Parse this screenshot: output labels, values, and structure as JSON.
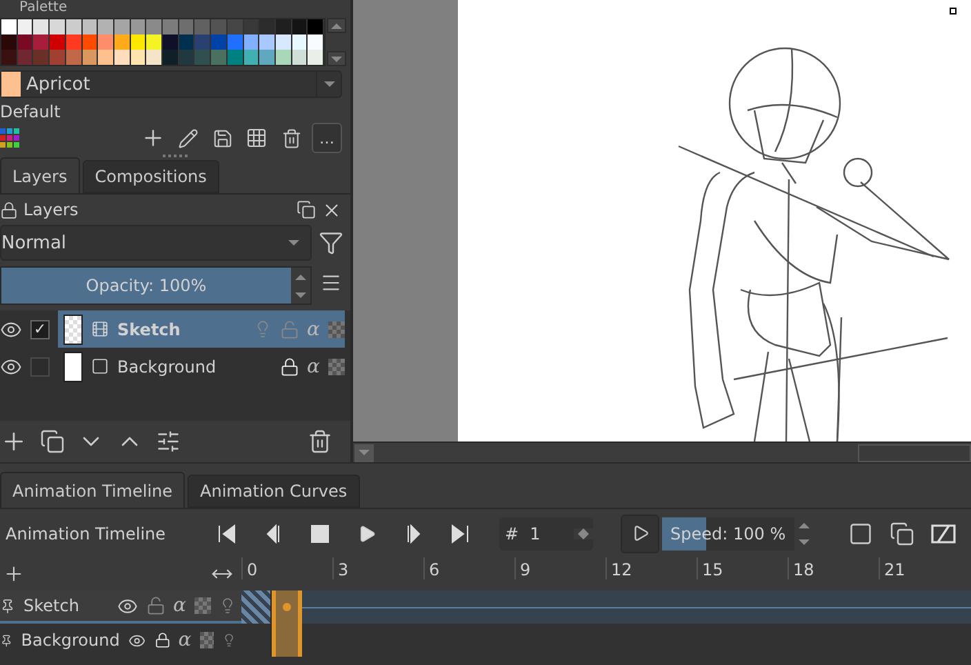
{
  "palette": {
    "title": "Palette",
    "swatches": [
      [
        {
          "color": "#ffffff"
        },
        {
          "color": "#f0f0f0"
        },
        {
          "color": "#e4e4e4"
        },
        {
          "color": "#d8d8d8"
        },
        {
          "color": "#cccccc"
        },
        {
          "color": "#bfbfbf"
        },
        {
          "color": "#b2b2b2"
        },
        {
          "color": "#a5a5a5"
        },
        {
          "color": "#989898"
        },
        {
          "color": "#8a8a8a"
        },
        {
          "color": "#7c7c7c"
        },
        {
          "color": "#6e6e6e"
        },
        {
          "color": "#616161"
        },
        {
          "color": "#535353"
        },
        {
          "color": "#464646"
        },
        {
          "color": "#393939"
        },
        {
          "color": "#2c2c2c"
        },
        {
          "color": "#1f1f1f"
        },
        {
          "color": "#141414"
        },
        {
          "color": "#000000"
        }
      ],
      [
        {
          "color": "#2a0808"
        },
        {
          "color": "#7a0a24"
        },
        {
          "color": "#a81e3a"
        },
        {
          "color": "#d00000"
        },
        {
          "color": "#ff3a20"
        },
        {
          "color": "#ff4a00"
        },
        {
          "color": "#ff8c6a"
        },
        {
          "color": "#ffaa18"
        },
        {
          "color": "#ffe800"
        },
        {
          "color": "#f4f424"
        },
        {
          "color": "#10102a"
        },
        {
          "color": "#003050"
        },
        {
          "color": "#2a4070"
        },
        {
          "color": "#0042a8"
        },
        {
          "color": "#2070ff"
        },
        {
          "color": "#80b0ff"
        },
        {
          "color": "#a8c8ff"
        },
        {
          "color": "#d8e8ff"
        },
        {
          "color": "#e8f8ff"
        },
        {
          "color": "#f8fcff"
        }
      ],
      [
        {
          "color": "#3a1010"
        },
        {
          "color": "#702830"
        },
        {
          "color": "#6a3028"
        },
        {
          "color": "#a04030"
        },
        {
          "color": "#c06848"
        },
        {
          "color": "#d89860"
        },
        {
          "color": "#ffc090"
        },
        {
          "color": "#ffdcbc"
        },
        {
          "color": "#ffe4b0"
        },
        {
          "color": "#f4e4c8"
        },
        {
          "color": "#102028"
        },
        {
          "color": "#203840"
        },
        {
          "color": "#305050"
        },
        {
          "color": "#4a7060"
        },
        {
          "color": "#008080"
        },
        {
          "color": "#40b0b0"
        },
        {
          "color": "#60a8c0"
        },
        {
          "color": "#a8d8b8"
        },
        {
          "color": "#d0e0d8"
        },
        {
          "color": "#e8f0e8"
        }
      ]
    ],
    "current": {
      "name": "Apricot",
      "color": "#ffc090"
    },
    "palette_name": "Default",
    "more_label": "…"
  },
  "dock_tabs": [
    {
      "label": "Layers",
      "selected": true
    },
    {
      "label": "Compositions",
      "selected": false
    }
  ],
  "layers_panel": {
    "title": "Layers",
    "blend_mode": "Normal",
    "opacity": {
      "label": "Opacity:  100%",
      "level": 1
    },
    "layers": [
      {
        "name": "Sketch",
        "selected": true,
        "checked": true,
        "check_mark": "✓",
        "locked": false,
        "animated": true,
        "alpha": "α"
      },
      {
        "name": "Background",
        "selected": false,
        "checked": false,
        "locked": true,
        "animated": false,
        "alpha": "α"
      }
    ]
  },
  "bottom_tabs": [
    {
      "label": "Animation Timeline",
      "selected": true
    },
    {
      "label": "Animation Curves",
      "selected": false
    }
  ],
  "timeline": {
    "title": "Animation Timeline",
    "frame_prefix": "#",
    "frame": "1",
    "speed": {
      "label": "Speed: 100 %",
      "level": 0.33
    },
    "frame_ticks": [
      "0",
      "3",
      "6",
      "9",
      "12",
      "15",
      "18",
      "21"
    ],
    "layers": [
      {
        "name": "Sketch",
        "selected": true,
        "locked": false,
        "alpha": "α",
        "cells": [
          {
            "kind": "onion",
            "selected": false
          },
          {
            "kind": "keyframe",
            "selected": true
          }
        ]
      },
      {
        "name": "Background",
        "selected": false,
        "locked": true,
        "alpha": "α",
        "cells": [
          {
            "kind": "empty",
            "selected": false
          },
          {
            "kind": "empty",
            "selected": true
          }
        ]
      }
    ]
  }
}
